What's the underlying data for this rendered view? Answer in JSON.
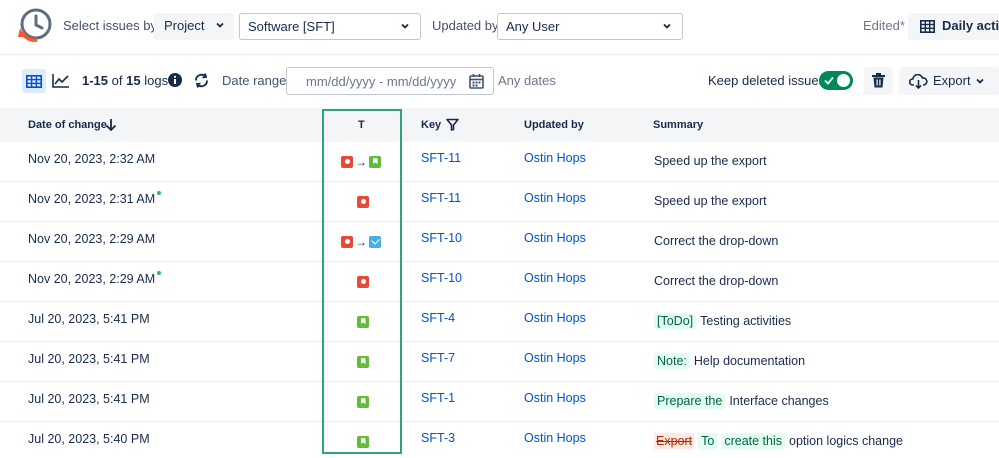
{
  "toolbar": {
    "select_issues_label": "Select issues by:",
    "scope_value": "Project",
    "project_value": "Software [SFT]",
    "updated_by_label": "Updated by:",
    "user_value": "Any User",
    "edited_label": "Edited*",
    "view_button_label": "Daily activi"
  },
  "controls": {
    "logs_range": "1-15",
    "logs_of": "of",
    "logs_total": "15",
    "logs_suffix": "logs",
    "date_range_label": "Date range:",
    "date_placeholder": "mm/dd/yyyy - mm/dd/yyyy",
    "any_dates": "Any dates",
    "keep_deleted_label": "Keep deleted issues",
    "keep_deleted_on": true,
    "export_label": "Export"
  },
  "columns": {
    "date": "Date of change",
    "type": "T",
    "key": "Key",
    "updated_by": "Updated by",
    "summary": "Summary"
  },
  "rows": [
    {
      "date": "Nov 20, 2023, 2:32 AM",
      "type_from": "bug",
      "type_to": "story",
      "key": "SFT-11",
      "user": "Ostin Hops",
      "summary_text": "Speed up the export"
    },
    {
      "date": "Nov 20, 2023, 2:31 AM",
      "type_from": "bug",
      "key": "SFT-11",
      "user": "Ostin Hops",
      "summary_text": "Speed up the export",
      "new": true
    },
    {
      "date": "Nov 20, 2023, 2:29 AM",
      "type_from": "bug",
      "type_to": "task",
      "key": "SFT-10",
      "user": "Ostin Hops",
      "summary_text": "Correct the drop-down"
    },
    {
      "date": "Nov 20, 2023, 2:29 AM",
      "type_from": "bug",
      "key": "SFT-10",
      "user": "Ostin Hops",
      "summary_text": "Correct the drop-down",
      "new": true
    },
    {
      "date": "Jul 20, 2023, 5:41 PM",
      "type_from": "story",
      "key": "SFT-4",
      "user": "Ostin Hops",
      "summary_tag": "[ToDo]",
      "summary_text": "Testing activities"
    },
    {
      "date": "Jul 20, 2023, 5:41 PM",
      "type_from": "story",
      "key": "SFT-7",
      "user": "Ostin Hops",
      "summary_tag": "Note:",
      "summary_text": "Help documentation"
    },
    {
      "date": "Jul 20, 2023, 5:41 PM",
      "type_from": "story",
      "key": "SFT-1",
      "user": "Ostin Hops",
      "summary_tag": "Prepare the",
      "summary_text": "Interface changes"
    },
    {
      "date": "Jul 20, 2023, 5:40 PM",
      "type_from": "story",
      "key": "SFT-3",
      "user": "Ostin Hops",
      "summary_del": "Export",
      "summary_tag": "To",
      "summary_tag2": "create this",
      "summary_text": "option logics change"
    }
  ],
  "colors": {
    "accent": "#0052cc",
    "toggle": "#00875a",
    "highlight": "#2ea283"
  }
}
